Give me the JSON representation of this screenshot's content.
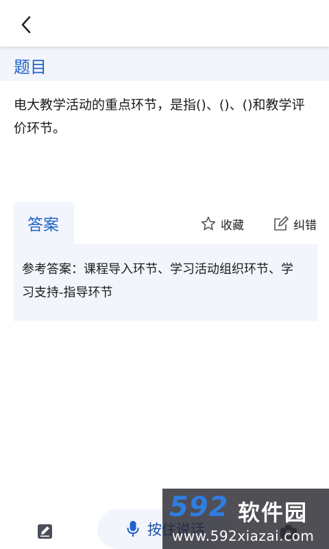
{
  "header": {
    "back_icon": "chevron-left-icon"
  },
  "question_section": {
    "title": "题目",
    "text": "电大教学活动的重点环节，是指()、()、()和教学评价环节。"
  },
  "answer_section": {
    "tab_label": "答案",
    "favorite_label": "收藏",
    "favorite_icon": "star-outline-icon",
    "correction_label": "纠错",
    "correction_icon": "edit-square-icon",
    "answer_text": "参考答案：课程导入环节、学习活动组织环节、学习支持-指导环节"
  },
  "bottom_bar": {
    "edit_icon": "pencil-note-icon",
    "voice_label": "按住说话",
    "voice_icon": "microphone-icon"
  },
  "watermark": {
    "logo": "592软件园",
    "url": "www.592xiazai.com"
  },
  "colors": {
    "accent": "#2162c8",
    "panel_bg": "#f2f5fb"
  }
}
